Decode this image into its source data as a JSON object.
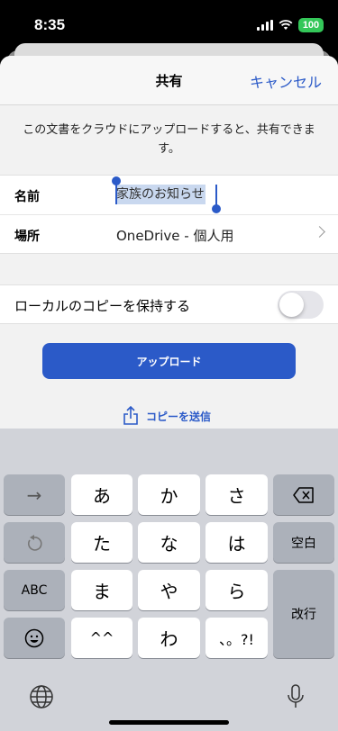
{
  "status": {
    "time": "8:35",
    "battery": "100"
  },
  "header": {
    "title": "共有",
    "cancel_label": "キャンセル"
  },
  "description": "この文書をクラウドにアップロードすると、共有できます。",
  "form": {
    "name_label": "名前",
    "name_value": "家族のお知らせ",
    "location_label": "場所",
    "location_value": "OneDrive - 個人用"
  },
  "local_copy": {
    "label": "ローカルのコピーを保持する",
    "enabled": false
  },
  "upload_button": "アップロード",
  "send_copy": "コピーを送信",
  "keyboard": {
    "row1": {
      "arrow": "→",
      "k1": "あ",
      "k2": "か",
      "k3": "さ"
    },
    "row2": {
      "k1": "た",
      "k2": "な",
      "k3": "は",
      "space": "空白"
    },
    "row3": {
      "abc": "ABC",
      "k1": "ま",
      "k2": "や",
      "k3": "ら",
      "enter": "改行"
    },
    "row4": {
      "k1": "^^",
      "k2": "わ",
      "k3": "、。?!"
    }
  },
  "colors": {
    "accent": "#2b5ac8",
    "battery": "#34c759"
  }
}
